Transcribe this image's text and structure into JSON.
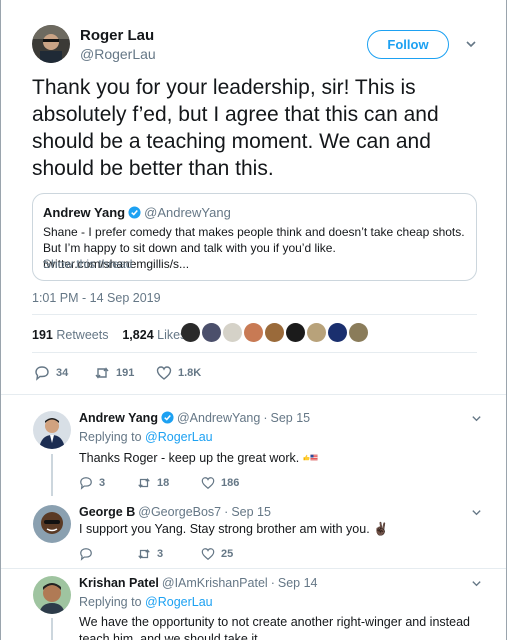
{
  "main_tweet": {
    "author_name": "Roger Lau",
    "author_handle": "@RogerLau",
    "follow_label": "Follow",
    "text": "Thank you for your leadership, sir! This is absolutely f’ed, but I agree that this can and should be a teaching moment. We can and should be better than this.",
    "quote": {
      "name": "Andrew Yang",
      "handle": "@AndrewYang",
      "text": "Shane - I prefer comedy that makes people think and doesn’t take cheap shots. But I’m happy to sit down and talk with you if you’d like. twitter.com/shanemgillis/s...",
      "show_thread": "Show this thread"
    },
    "timestamp": "1:01 PM - 14 Sep 2019",
    "retweets_count": "191",
    "retweets_label": "Retweets",
    "likes_count": "1,824",
    "likes_label": "Likes",
    "reply_count": "34",
    "retweet_action_count": "191",
    "like_action_count": "1.8K"
  },
  "replies": [
    {
      "name": "Andrew Yang",
      "handle": "@AndrewYang",
      "date": "Sep 15",
      "replying_prefix": "Replying to",
      "replying_to": "@RogerLau",
      "text": "Thanks Roger - keep up the great work.",
      "reply_count": "3",
      "retweet_count": "18",
      "like_count": "186"
    },
    {
      "name": "George B",
      "handle": "@GeorgeBos7",
      "date": "Sep 15",
      "text": "I support you Yang. Stay strong brother am with you. ✌🏿",
      "reply_count": "",
      "retweet_count": "3",
      "like_count": "25"
    },
    {
      "name": "Krishan Patel",
      "handle": "@IAmKrishanPatel",
      "date": "Sep 14",
      "replying_prefix": "Replying to",
      "replying_to": "@RogerLau",
      "text": "We have the opportunity to not create another right-winger and instead teach him, and we should take it."
    }
  ],
  "colors": {
    "accent": "#1da1f2",
    "muted": "#657786",
    "text": "#14171a",
    "border": "#e6ecf0"
  }
}
